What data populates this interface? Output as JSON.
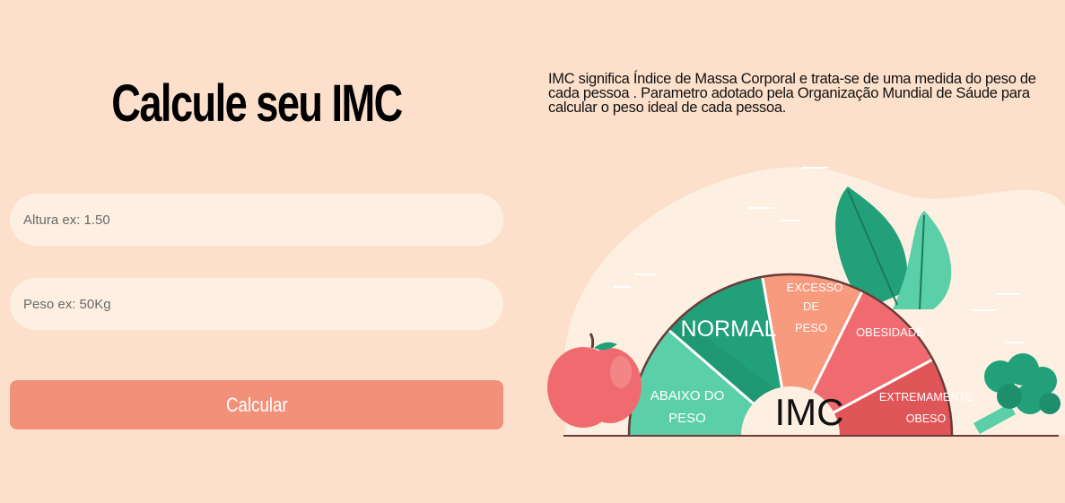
{
  "heading": "Calcule seu IMC",
  "form": {
    "altura_placeholder": "Altura ex: 1.50",
    "peso_placeholder": "Peso ex: 50Kg",
    "submit_label": "Calcular"
  },
  "description": "IMC significa Índice de Massa Corporal e trata-se de uma medida do peso de cada pessoa . Parametro adotado pela Organização Mundial de Sáude para calcular o peso ideal de cada pessoa.",
  "gauge": {
    "center_label": "IMC",
    "segments": {
      "abaixo_l1": "ABAIXO DO",
      "abaixo_l2": "PESO",
      "normal": "NORMAL",
      "excesso_l1": "EXCESSO",
      "excesso_l2": "DE",
      "excesso_l3": "PESO",
      "obesidade": "OBESIDADE",
      "extremamente_l1": "EXTREMAMENTE",
      "extremamente_l2": "OBESO"
    }
  },
  "colors": {
    "background": "#fde0cb",
    "input_bg": "#fdf0e2",
    "button": "#f2917a",
    "abaixo": "#5bcfa8",
    "normal": "#22a07a",
    "excesso": "#f79a7d",
    "obesidade": "#f06b70",
    "extremamente": "#e05558"
  }
}
